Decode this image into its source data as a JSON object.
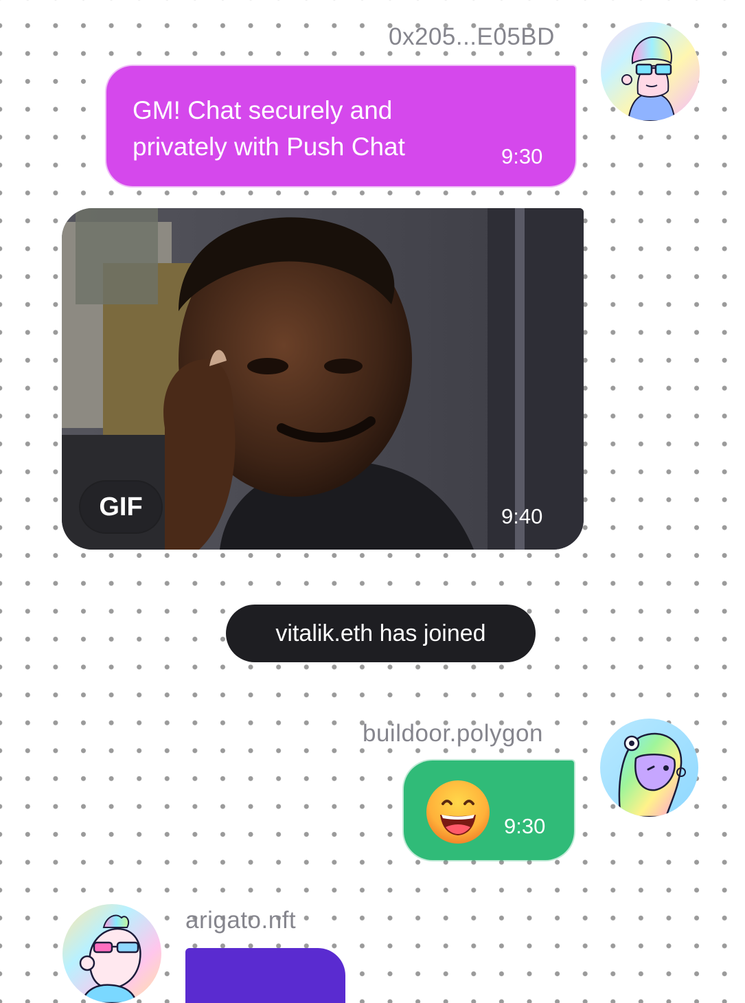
{
  "messages": [
    {
      "sender": "0x205...E05BD",
      "text": "GM! Chat securely and privately with Push Chat",
      "time": "9:30",
      "avatar_icon": "pfp-glasses-hoodie-icon"
    },
    {
      "type": "gif",
      "badge": "GIF",
      "time": "9:40"
    },
    {
      "type": "system",
      "text": "vitalik.eth has joined"
    },
    {
      "sender": "buildoor.polygon",
      "emoji": "😄",
      "emoji_icon": "grinning-face-emoji-icon",
      "time": "9:30",
      "avatar_icon": "pfp-dino-rainbow-icon"
    },
    {
      "sender": "arigato.nft",
      "avatar_icon": "pfp-bird-sunglasses-icon"
    }
  ],
  "colors": {
    "text_bubble": "#d548ec",
    "emoji_bubble": "#30bb78",
    "system_pill": "#1e1e22",
    "partial_bubble": "#5a2bd0",
    "sender_text": "#85858d"
  }
}
